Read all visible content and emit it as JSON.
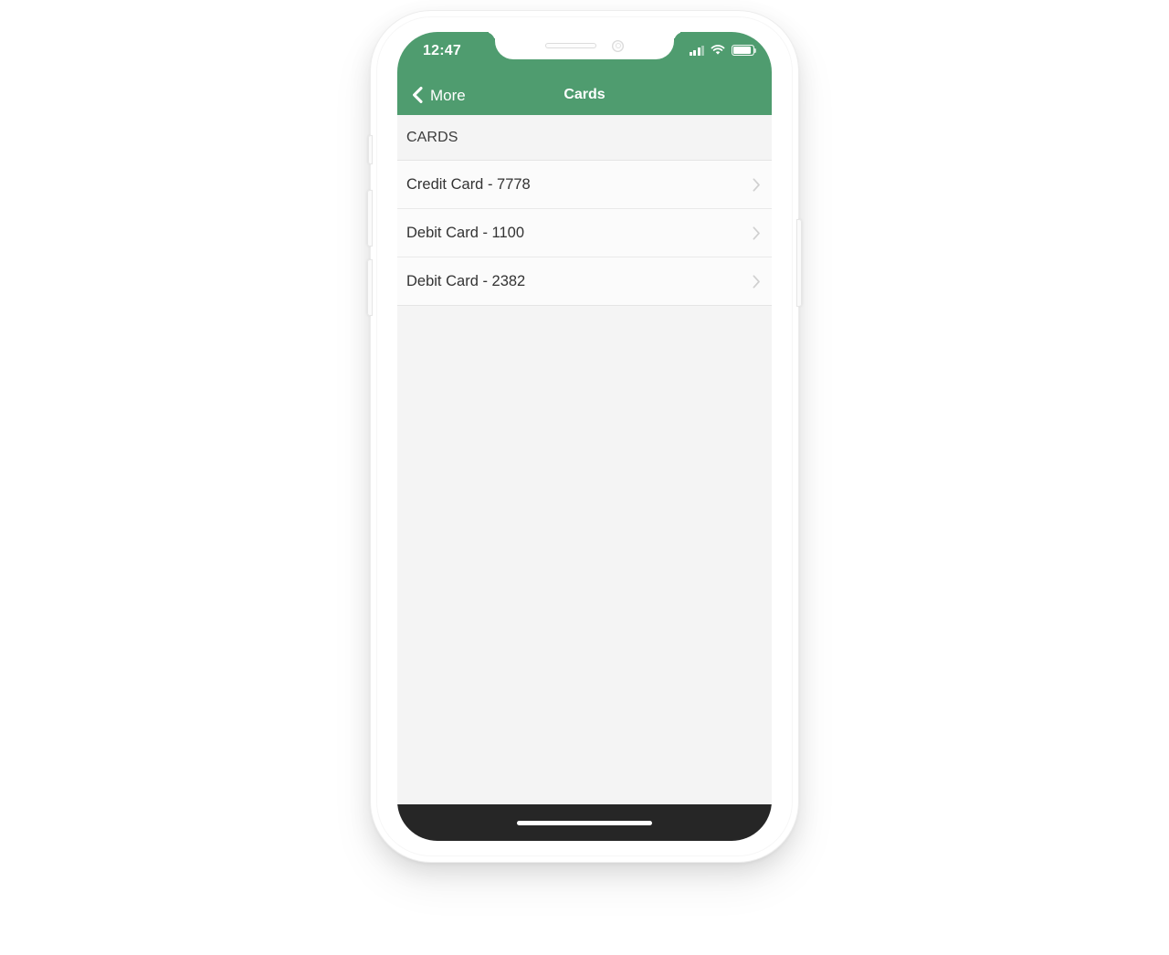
{
  "device": {
    "hardware_buttons": {
      "silent_switch": "silent-switch",
      "volume_up": "volume-up-button",
      "volume_down": "volume-down-button",
      "power": "power-button"
    },
    "notch": {
      "speaker": "earpiece-speaker",
      "camera": "front-camera"
    },
    "home_indicator": "home-indicator"
  },
  "status_bar": {
    "time": "12:47",
    "icons": {
      "signal": "signal-bars-icon",
      "wifi": "wifi-icon",
      "battery": "battery-icon"
    }
  },
  "nav_bar": {
    "back_label": "More",
    "back_icon": "chevron-left-icon",
    "title": "Cards"
  },
  "content": {
    "section_header": "CARDS",
    "rows": [
      {
        "label": "Credit Card - 7778",
        "accessory": "chevron-right-icon"
      },
      {
        "label": "Debit Card - 1100",
        "accessory": "chevron-right-icon"
      },
      {
        "label": "Debit Card - 2382",
        "accessory": "chevron-right-icon"
      }
    ]
  },
  "colors": {
    "accent_green": "#4f9c6f",
    "page_background": "#f4f4f4",
    "row_background": "#fbfbfb",
    "separator": "#e9e9e9",
    "text_primary": "#333333",
    "home_bar": "#262626"
  }
}
